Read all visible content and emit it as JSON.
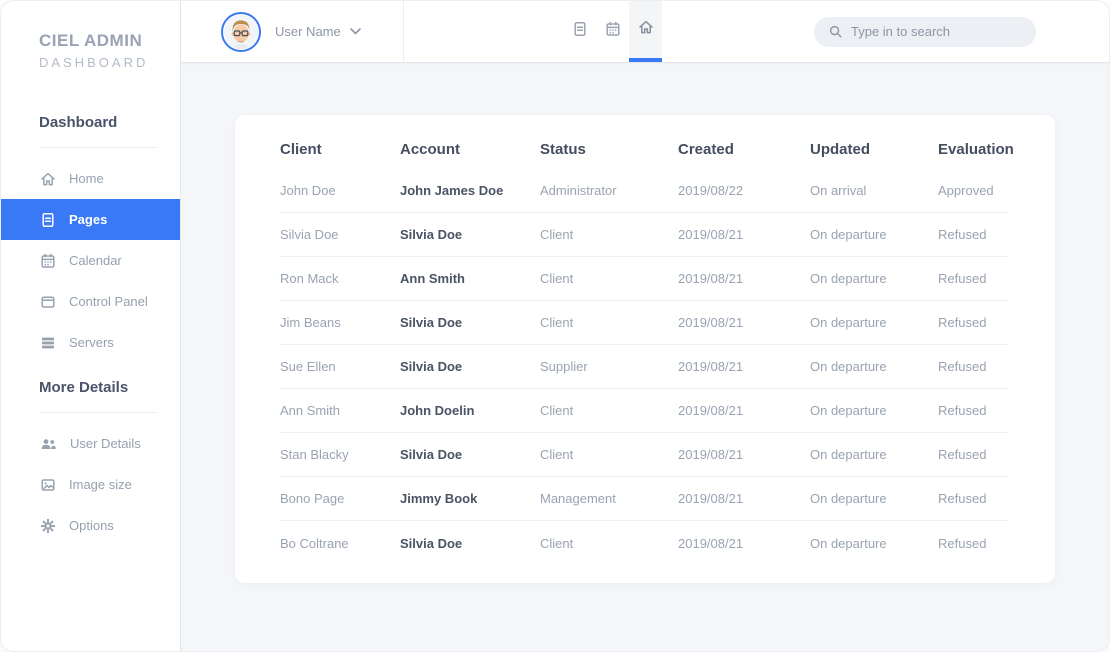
{
  "app": {
    "accent_color": "#3a79f5"
  },
  "sidebar": {
    "logo": {
      "line1": "CIEL ADMIN",
      "line2": "DASHBOARD"
    },
    "sections": [
      {
        "header": "Dashboard",
        "items": [
          {
            "label": "Home",
            "icon": "home",
            "active": false
          },
          {
            "label": "Pages",
            "icon": "file",
            "active": true
          },
          {
            "label": "Calendar",
            "icon": "calendar",
            "active": false
          },
          {
            "label": "Control Panel",
            "icon": "panel",
            "active": false
          },
          {
            "label": "Servers",
            "icon": "servers",
            "active": false
          }
        ]
      },
      {
        "header": "More Details",
        "items": [
          {
            "label": "User Details",
            "icon": "users",
            "active": false
          },
          {
            "label": "Image size",
            "icon": "image",
            "active": false
          },
          {
            "label": "Options",
            "icon": "gear",
            "active": false
          }
        ]
      }
    ]
  },
  "topbar": {
    "user_name": "User Name",
    "tabs": [
      {
        "icon": "file",
        "active": false
      },
      {
        "icon": "calendar",
        "active": false
      },
      {
        "icon": "home",
        "active": true
      }
    ],
    "search_placeholder": "Type in to search"
  },
  "table": {
    "columns": [
      "Client",
      "Account",
      "Status",
      "Created",
      "Updated",
      "Evaluation"
    ],
    "rows": [
      {
        "client": "John Doe",
        "account": "John James Doe",
        "status": "Administrator",
        "created": "2019/08/22",
        "updated": "On arrival",
        "evaluation": "Approved"
      },
      {
        "client": "Silvia Doe",
        "account": "Silvia Doe",
        "status": "Client",
        "created": "2019/08/21",
        "updated": "On departure",
        "evaluation": "Refused"
      },
      {
        "client": "Ron Mack",
        "account": "Ann Smith",
        "status": "Client",
        "created": "2019/08/21",
        "updated": "On departure",
        "evaluation": "Refused"
      },
      {
        "client": "Jim Beans",
        "account": "Silvia Doe",
        "status": "Client",
        "created": "2019/08/21",
        "updated": "On departure",
        "evaluation": "Refused"
      },
      {
        "client": "Sue Ellen",
        "account": "Silvia Doe",
        "status": "Supplier",
        "created": "2019/08/21",
        "updated": "On departure",
        "evaluation": "Refused"
      },
      {
        "client": "Ann Smith",
        "account": "John Doelin",
        "status": "Client",
        "created": "2019/08/21",
        "updated": "On departure",
        "evaluation": "Refused"
      },
      {
        "client": "Stan Blacky",
        "account": "Silvia Doe",
        "status": "Client",
        "created": "2019/08/21",
        "updated": "On departure",
        "evaluation": "Refused"
      },
      {
        "client": "Bono Page",
        "account": "Jimmy Book",
        "status": "Management",
        "created": "2019/08/21",
        "updated": "On departure",
        "evaluation": "Refused"
      },
      {
        "client": "Bo Coltrane",
        "account": "Silvia Doe",
        "status": "Client",
        "created": "2019/08/21",
        "updated": "On departure",
        "evaluation": "Refused"
      }
    ]
  }
}
